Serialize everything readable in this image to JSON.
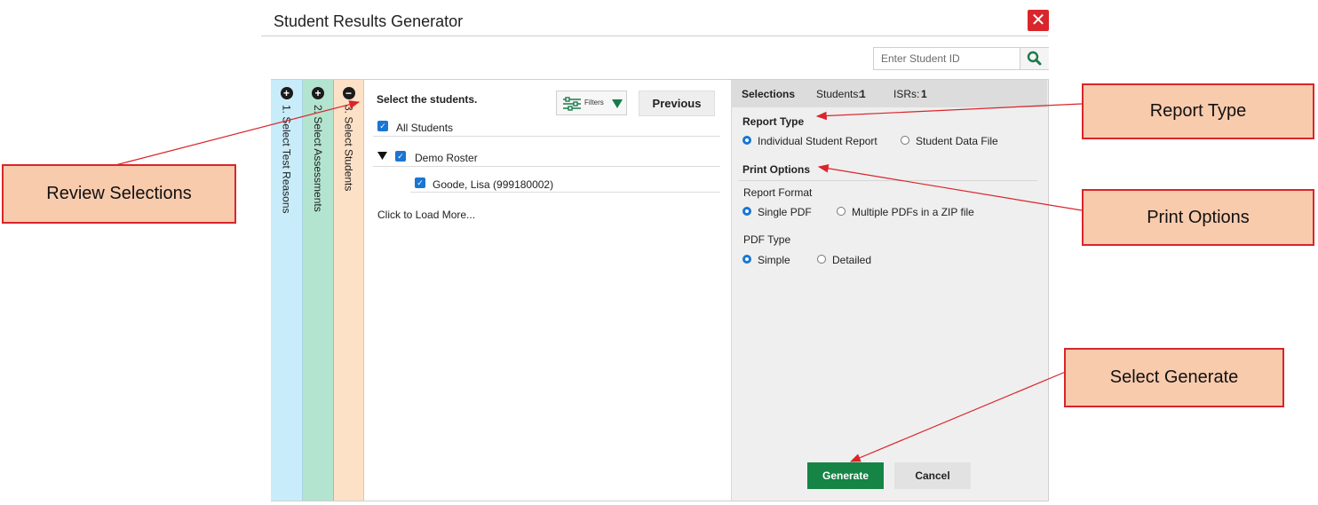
{
  "window": {
    "title": "Student Results Generator"
  },
  "search": {
    "placeholder": "Enter Student ID"
  },
  "steps": [
    {
      "icon": "plus",
      "label": "1. Select Test Reasons"
    },
    {
      "icon": "plus",
      "label": "2. Select Assessments"
    },
    {
      "icon": "minus",
      "label": "3. Select Students"
    }
  ],
  "students": {
    "heading": "Select the students.",
    "filters_label": "Filters",
    "previous_label": "Previous",
    "all_label": "All Students",
    "roster_label": "Demo Roster",
    "student_label": "Goode, Lisa (999180002)",
    "load_more": "Click to Load More..."
  },
  "selections": {
    "title": "Selections",
    "students_label": "Students:",
    "students_count": "1",
    "isrs_label": "ISRs:",
    "isrs_count": "1",
    "report_type_title": "Report Type",
    "report_type_options": [
      "Individual Student Report",
      "Student Data File"
    ],
    "print_options_title": "Print Options",
    "report_format_label": "Report Format",
    "report_format_options": [
      "Single PDF",
      "Multiple PDFs in a ZIP file"
    ],
    "pdf_type_label": "PDF Type",
    "pdf_type_options": [
      "Simple",
      "Detailed"
    ],
    "generate_label": "Generate",
    "cancel_label": "Cancel"
  },
  "callouts": {
    "review": "Review Selections",
    "report_type": "Report Type",
    "print_options": "Print Options",
    "generate": "Select Generate"
  },
  "colors": {
    "step1": "#c9ecfa",
    "step2": "#b3e4cf",
    "step3": "#fde1c6",
    "accent": "#1976d2",
    "generate": "#158445",
    "close": "#d9252b",
    "callout_fill": "#f8cbad",
    "callout_border": "#d9252b"
  },
  "icons": [
    "close-icon",
    "search-icon",
    "plus-circle-icon",
    "minus-circle-icon",
    "sliders-icon",
    "caret-down-icon",
    "checkbox-icon",
    "radio-icon"
  ]
}
